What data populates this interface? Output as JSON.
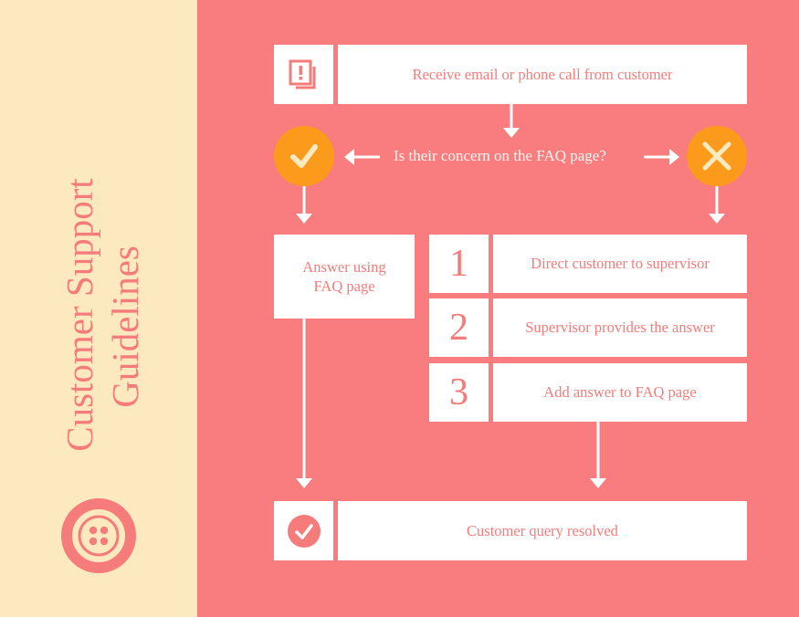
{
  "sidebar": {
    "title_line1": "Customer Support",
    "title_line2": "Guidelines",
    "logo_icon": "button-icon"
  },
  "flow": {
    "start": {
      "icon": "alert-document-icon",
      "label": "Receive email or phone call from customer"
    },
    "question": {
      "label": "Is their concern on the FAQ page?"
    },
    "yes": {
      "icon": "checkmark-icon"
    },
    "no": {
      "icon": "x-icon"
    },
    "yes_branch": {
      "label_line1": "Answer using",
      "label_line2": "FAQ page"
    },
    "no_branch": {
      "steps": [
        {
          "number": "1",
          "label": "Direct customer to supervisor"
        },
        {
          "number": "2",
          "label": "Supervisor provides the answer"
        },
        {
          "number": "3",
          "label": "Add answer to FAQ page"
        }
      ]
    },
    "end": {
      "icon": "check-circle-icon",
      "label": "Customer query resolved"
    }
  },
  "colors": {
    "background": "#f97d7f",
    "sidebar": "#fde9c0",
    "accent_text": "#f57c7a",
    "decision_circle": "#fb9a1b",
    "decision_mark": "#fde9c0",
    "box": "#ffffff"
  }
}
